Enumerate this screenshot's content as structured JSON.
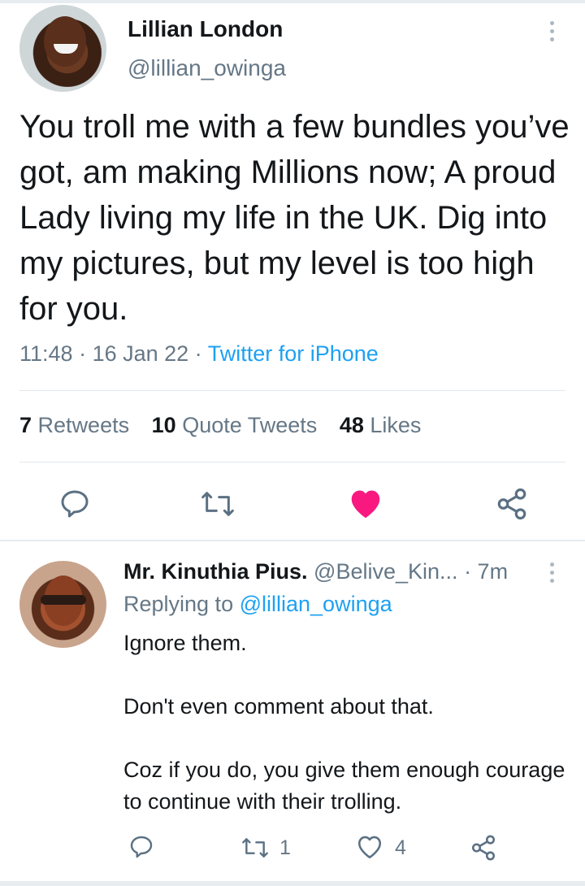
{
  "tweet": {
    "author_name": "Lillian London",
    "author_handle": "@lillian_owinga",
    "text": "You troll me with a few bundles you’ve got, am making Millions now; A proud Lady living my life in the UK. Dig into my pictures, but my level is too high for you.",
    "time": "11:48",
    "date": "16 Jan 22",
    "source": "Twitter for iPhone",
    "retweets_count": "7",
    "retweets_label": "Retweets",
    "quotes_count": "10",
    "quotes_label": "Quote Tweets",
    "likes_count": "48",
    "likes_label": "Likes",
    "liked": true,
    "like_color": "#f91880"
  },
  "reply": {
    "author_name": "Mr. Kinuthia Pius.",
    "author_handle": "@Belive_Kin...",
    "time": "· 7m",
    "replying_prefix": "Replying to",
    "replying_to": "@lillian_owinga",
    "lines": [
      "Ignore them.",
      "Don't even comment about that.",
      "Coz if you do, you give them enough courage to continue with their trolling."
    ],
    "retweet_count": "1",
    "like_count": "4"
  },
  "colors": {
    "accent": "#1da1f2",
    "secondary_text": "#657786",
    "icon": "#5b7083"
  },
  "icons": [
    "more-vertical-icon",
    "reply-icon",
    "retweet-icon",
    "heart-icon",
    "share-icon"
  ]
}
